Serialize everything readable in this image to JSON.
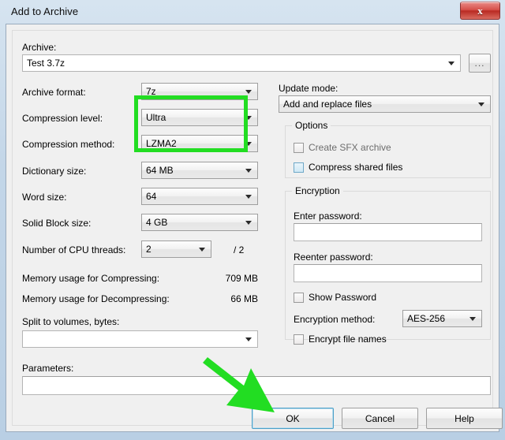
{
  "window": {
    "title": "Add to Archive",
    "close_label": "x",
    "close_icon": "close-icon"
  },
  "archive": {
    "label": "Archive:",
    "value": "Test 3.7z",
    "browse_label": "..."
  },
  "left_column": {
    "archive_format": {
      "label": "Archive format:",
      "value": "7z"
    },
    "compression_level": {
      "label": "Compression level:",
      "value": "Ultra"
    },
    "compression_method": {
      "label": "Compression method:",
      "value": "LZMA2"
    },
    "dictionary_size": {
      "label": "Dictionary size:",
      "value": "64 MB"
    },
    "word_size": {
      "label": "Word size:",
      "value": "64"
    },
    "solid_block_size": {
      "label": "Solid Block size:",
      "value": "4 GB"
    },
    "cpu_threads": {
      "label": "Number of CPU threads:",
      "value": "2",
      "max": "/ 2"
    },
    "memory_compressing": {
      "label": "Memory usage for Compressing:",
      "value": "709 MB"
    },
    "memory_decompressing": {
      "label": "Memory usage for Decompressing:",
      "value": "66 MB"
    },
    "split_volumes": {
      "label": "Split to volumes, bytes:",
      "value": ""
    },
    "parameters": {
      "label": "Parameters:",
      "value": ""
    }
  },
  "right_column": {
    "update_mode": {
      "label": "Update mode:",
      "value": "Add and replace files"
    },
    "options": {
      "title": "Options",
      "items": [
        {
          "label": "Create SFX archive",
          "checked": false,
          "disabled": true,
          "style": "plain"
        },
        {
          "label": "Compress shared files",
          "checked": false,
          "disabled": false,
          "style": "blue"
        }
      ]
    },
    "encryption": {
      "title": "Encryption",
      "enter_password_label": "Enter password:",
      "enter_password_value": "",
      "reenter_password_label": "Reenter password:",
      "reenter_password_value": "",
      "show_password_label": "Show Password",
      "encryption_method_label": "Encryption method:",
      "encryption_method_value": "AES-256",
      "encrypt_file_names_label": "Encrypt file names"
    }
  },
  "buttons": {
    "ok": "OK",
    "cancel": "Cancel",
    "help": "Help"
  },
  "annotations": {
    "highlight_color": "#22dd22",
    "arrow_color": "#22dd22",
    "highlight_target": "compression-level-and-method",
    "arrow_target": "ok-button"
  }
}
